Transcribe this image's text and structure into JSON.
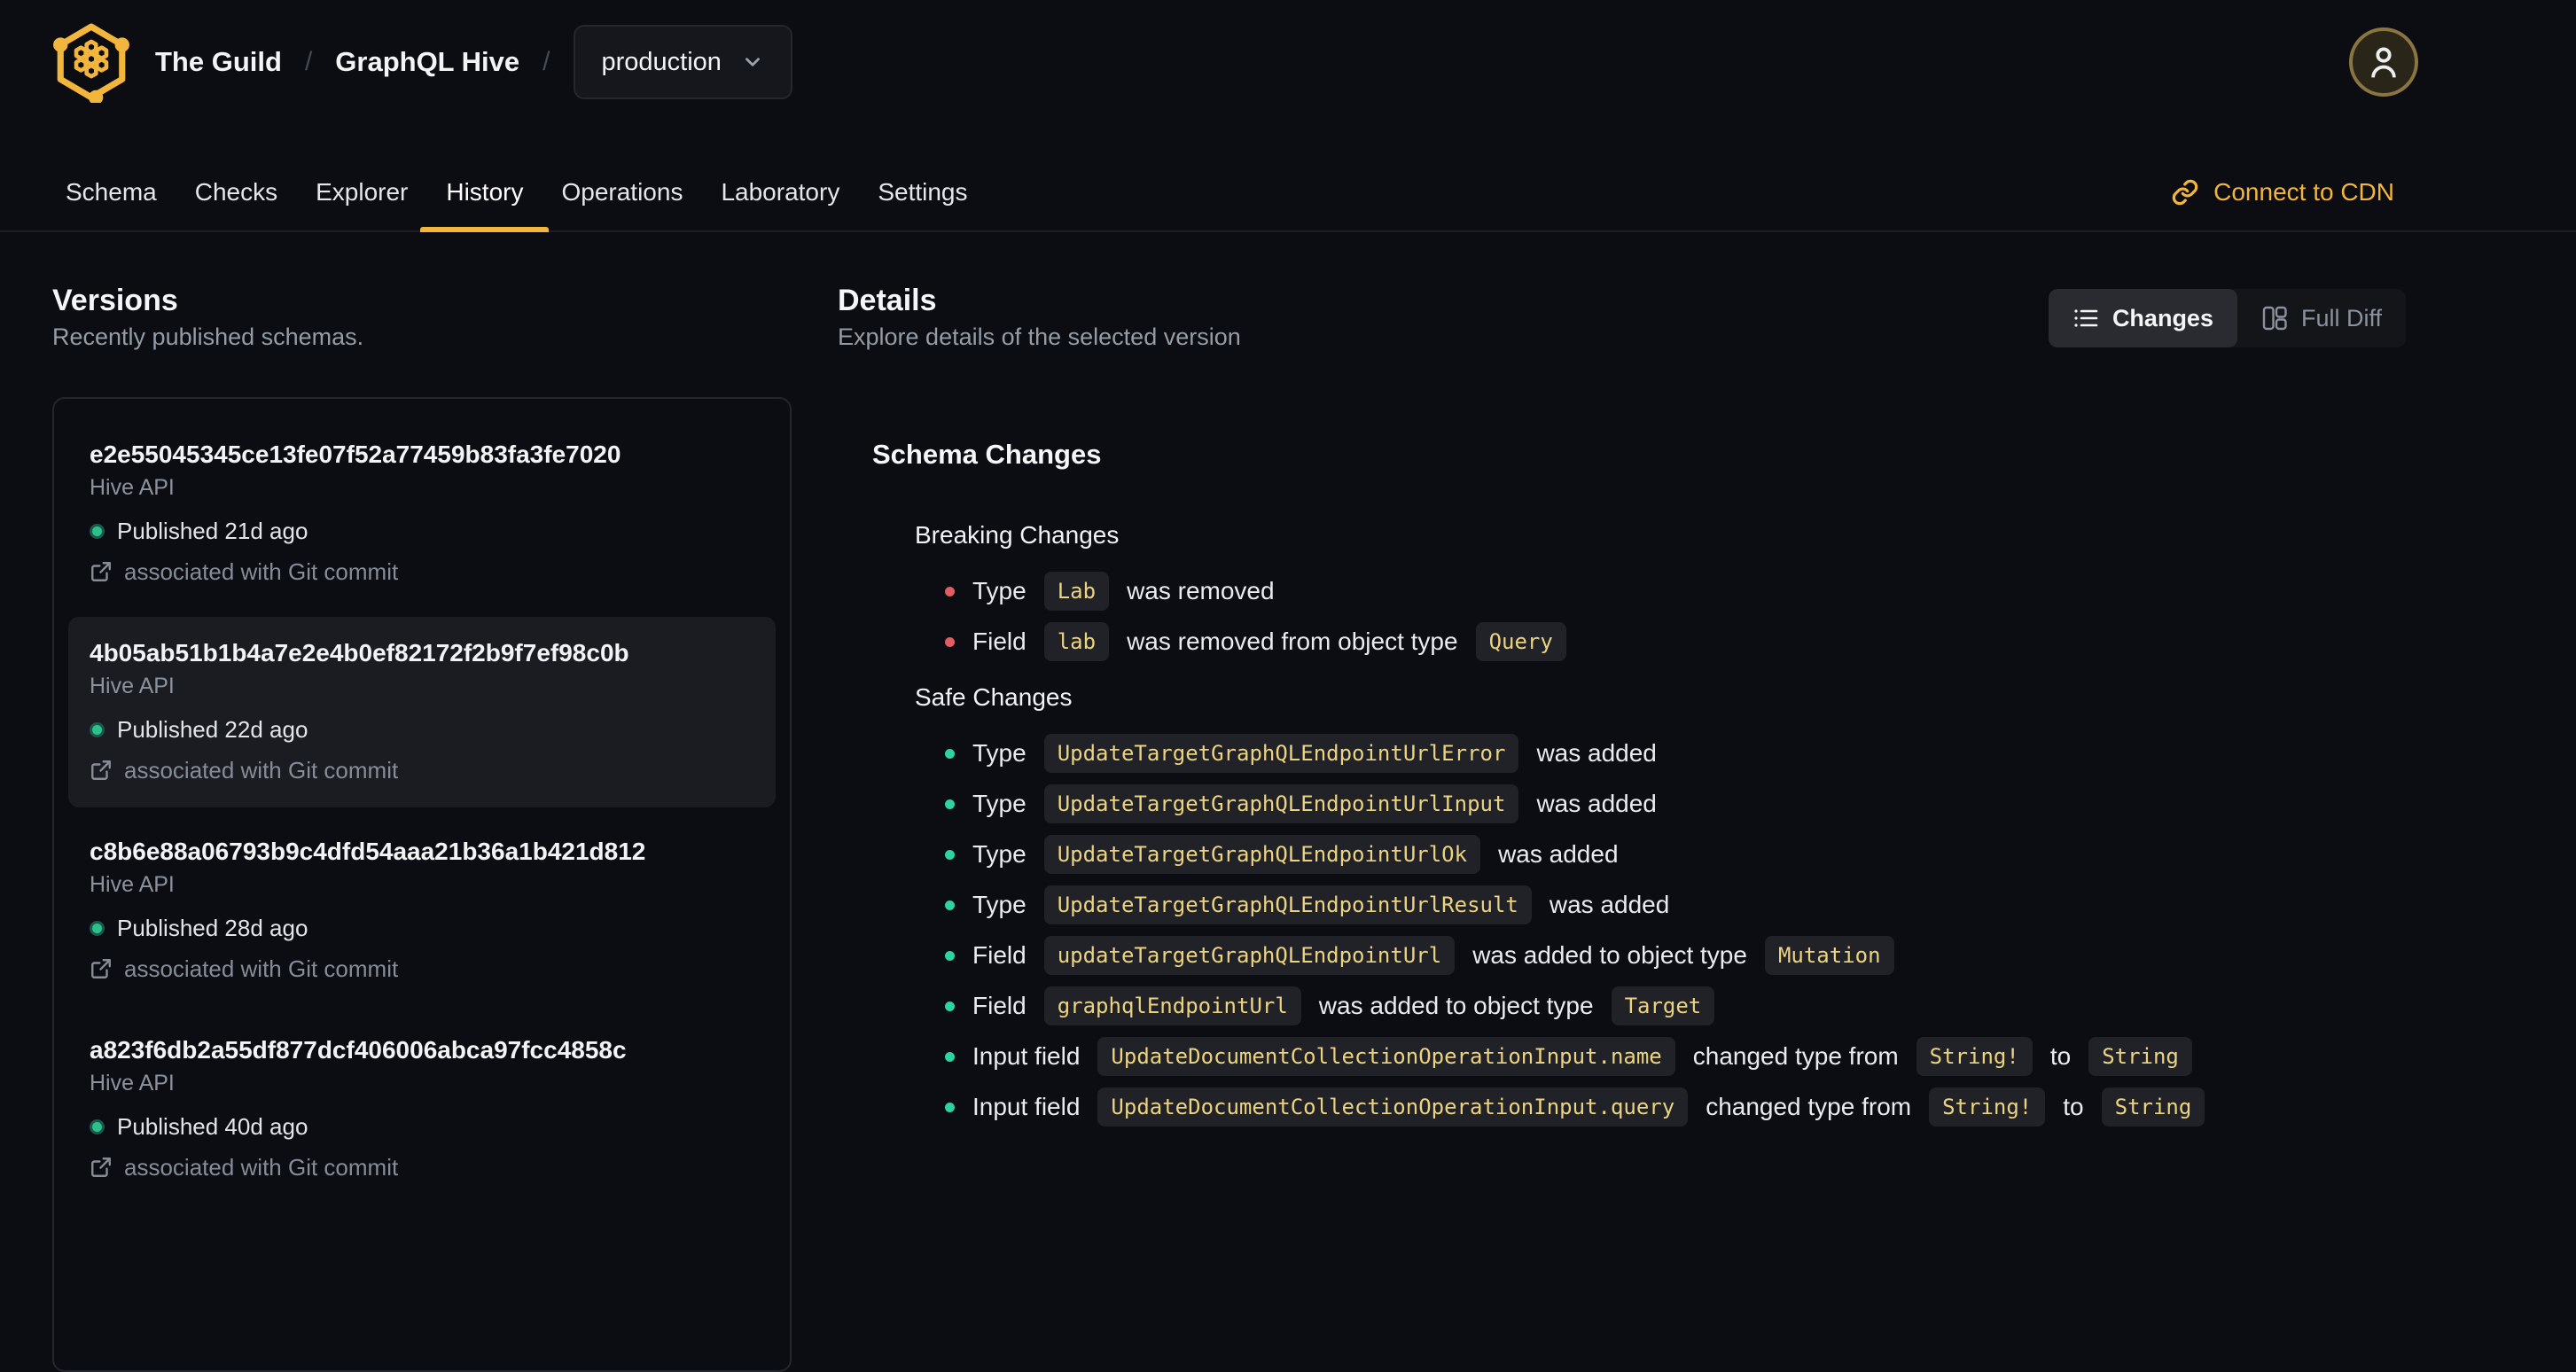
{
  "header": {
    "org": "The Guild",
    "project": "GraphQL Hive",
    "separator": "/",
    "target_selector": {
      "value": "production"
    }
  },
  "nav": {
    "tabs": [
      {
        "label": "Schema",
        "active": false
      },
      {
        "label": "Checks",
        "active": false
      },
      {
        "label": "Explorer",
        "active": false
      },
      {
        "label": "History",
        "active": true
      },
      {
        "label": "Operations",
        "active": false
      },
      {
        "label": "Laboratory",
        "active": false
      },
      {
        "label": "Settings",
        "active": false
      }
    ],
    "connect_cdn_label": "Connect to CDN"
  },
  "versions_panel": {
    "title": "Versions",
    "subtitle": "Recently published schemas.",
    "items": [
      {
        "hash": "e2e55045345ce13fe07f52a77459b83fa3fe7020",
        "service": "Hive API",
        "status": "Published 21d ago",
        "git": "associated with Git commit",
        "selected": false
      },
      {
        "hash": "4b05ab51b1b4a7e2e4b0ef82172f2b9f7ef98c0b",
        "service": "Hive API",
        "status": "Published 22d ago",
        "git": "associated with Git commit",
        "selected": true
      },
      {
        "hash": "c8b6e88a06793b9c4dfd54aaa21b36a1b421d812",
        "service": "Hive API",
        "status": "Published 28d ago",
        "git": "associated with Git commit",
        "selected": false
      },
      {
        "hash": "a823f6db2a55df877dcf406006abca97fcc4858c",
        "service": "Hive API",
        "status": "Published 40d ago",
        "git": "associated with Git commit",
        "selected": false
      }
    ]
  },
  "details_panel": {
    "title": "Details",
    "subtitle": "Explore details of the selected version",
    "view_toggle": {
      "changes_label": "Changes",
      "full_diff_label": "Full Diff"
    },
    "schema_changes": {
      "title": "Schema Changes",
      "breaking": {
        "title": "Breaking Changes",
        "items": [
          [
            {
              "t": "text",
              "v": "Type"
            },
            {
              "t": "code",
              "v": "Lab"
            },
            {
              "t": "text",
              "v": "was removed"
            }
          ],
          [
            {
              "t": "text",
              "v": "Field"
            },
            {
              "t": "code",
              "v": "lab"
            },
            {
              "t": "text",
              "v": "was removed from object type"
            },
            {
              "t": "code",
              "v": "Query"
            }
          ]
        ]
      },
      "safe": {
        "title": "Safe Changes",
        "items": [
          [
            {
              "t": "text",
              "v": "Type"
            },
            {
              "t": "code",
              "v": "UpdateTargetGraphQLEndpointUrlError"
            },
            {
              "t": "text",
              "v": "was added"
            }
          ],
          [
            {
              "t": "text",
              "v": "Type"
            },
            {
              "t": "code",
              "v": "UpdateTargetGraphQLEndpointUrlInput"
            },
            {
              "t": "text",
              "v": "was added"
            }
          ],
          [
            {
              "t": "text",
              "v": "Type"
            },
            {
              "t": "code",
              "v": "UpdateTargetGraphQLEndpointUrlOk"
            },
            {
              "t": "text",
              "v": "was added"
            }
          ],
          [
            {
              "t": "text",
              "v": "Type"
            },
            {
              "t": "code",
              "v": "UpdateTargetGraphQLEndpointUrlResult"
            },
            {
              "t": "text",
              "v": "was added"
            }
          ],
          [
            {
              "t": "text",
              "v": "Field"
            },
            {
              "t": "code",
              "v": "updateTargetGraphQLEndpointUrl"
            },
            {
              "t": "text",
              "v": "was added to object type"
            },
            {
              "t": "code",
              "v": "Mutation"
            }
          ],
          [
            {
              "t": "text",
              "v": "Field"
            },
            {
              "t": "code",
              "v": "graphqlEndpointUrl"
            },
            {
              "t": "text",
              "v": "was added to object type"
            },
            {
              "t": "code",
              "v": "Target"
            }
          ],
          [
            {
              "t": "text",
              "v": "Input field"
            },
            {
              "t": "code",
              "v": "UpdateDocumentCollectionOperationInput.name"
            },
            {
              "t": "text",
              "v": "changed type from"
            },
            {
              "t": "code",
              "v": "String!"
            },
            {
              "t": "text",
              "v": "to"
            },
            {
              "t": "code",
              "v": "String"
            }
          ],
          [
            {
              "t": "text",
              "v": "Input field"
            },
            {
              "t": "code",
              "v": "UpdateDocumentCollectionOperationInput.query"
            },
            {
              "t": "text",
              "v": "changed type from"
            },
            {
              "t": "code",
              "v": "String!"
            },
            {
              "t": "text",
              "v": "to"
            },
            {
              "t": "code",
              "v": "String"
            }
          ]
        ]
      }
    }
  },
  "colors": {
    "accent_amber": "#f3b63c",
    "breaking_bullet": "#e25c63",
    "safe_bullet": "#2dd4a0",
    "published_dot": "#2ec08a",
    "code_text": "#ecd381",
    "background": "#0b0d12"
  }
}
